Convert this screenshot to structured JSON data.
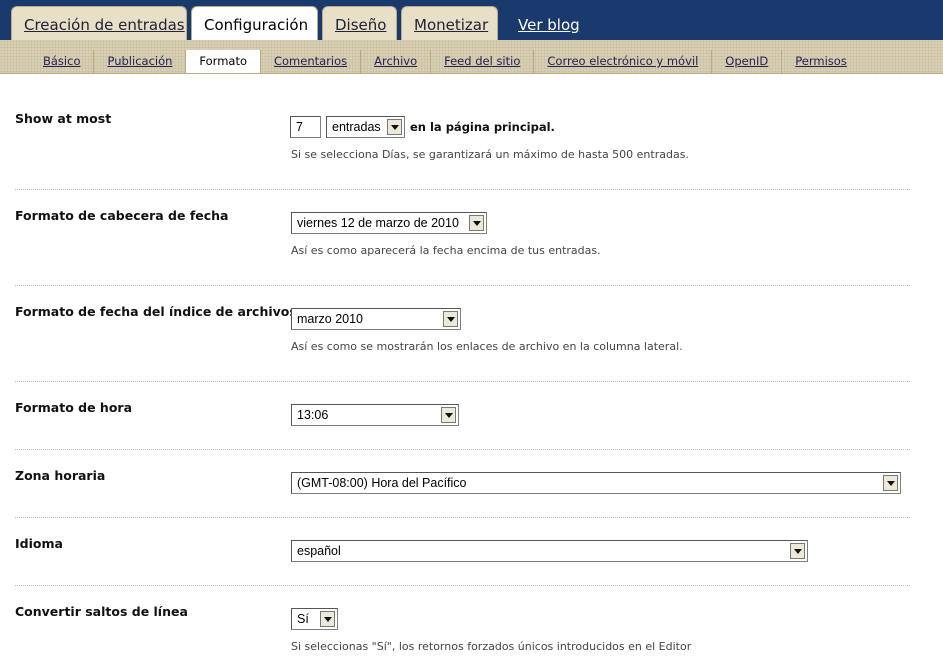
{
  "tabs": [
    {
      "label": "Creación de entradas",
      "active": false
    },
    {
      "label": "Configuración",
      "active": true
    },
    {
      "label": "Diseño",
      "active": false
    },
    {
      "label": "Monetizar",
      "active": false
    }
  ],
  "view_blog": "Ver blog",
  "subtabs": [
    "Básico",
    "Publicación",
    "Formato",
    "Comentarios",
    "Archivo",
    "Feed del sitio",
    "Correo electrónico y móvil",
    "OpenID",
    "Permisos"
  ],
  "active_subtab": "Formato",
  "settings": {
    "show_at_most": {
      "label": "Show at most",
      "count": "7",
      "unit": "entradas",
      "suffix": "en la página principal.",
      "help": "Si se selecciona Días, se garantizará un máximo de hasta 500 entradas."
    },
    "date_header": {
      "label": "Formato de cabecera de fecha",
      "value": "viernes 12 de marzo de 2010",
      "help": "Así es como aparecerá la fecha encima de tus entradas."
    },
    "archive_date": {
      "label": "Formato de fecha del índice de archivos",
      "value": "marzo 2010",
      "help": "Así es como se mostrarán los enlaces de archivo en la columna lateral."
    },
    "time_format": {
      "label": "Formato de hora",
      "value": "13:06"
    },
    "timezone": {
      "label": "Zona horaria",
      "value": "(GMT-08:00) Hora del Pacífico"
    },
    "language": {
      "label": "Idioma",
      "value": "español"
    },
    "line_breaks": {
      "label": "Convertir saltos de línea",
      "value": "Sí",
      "help": "Si seleccionas \"Sí\", los retornos forzados únicos introducidos en el Editor"
    }
  }
}
